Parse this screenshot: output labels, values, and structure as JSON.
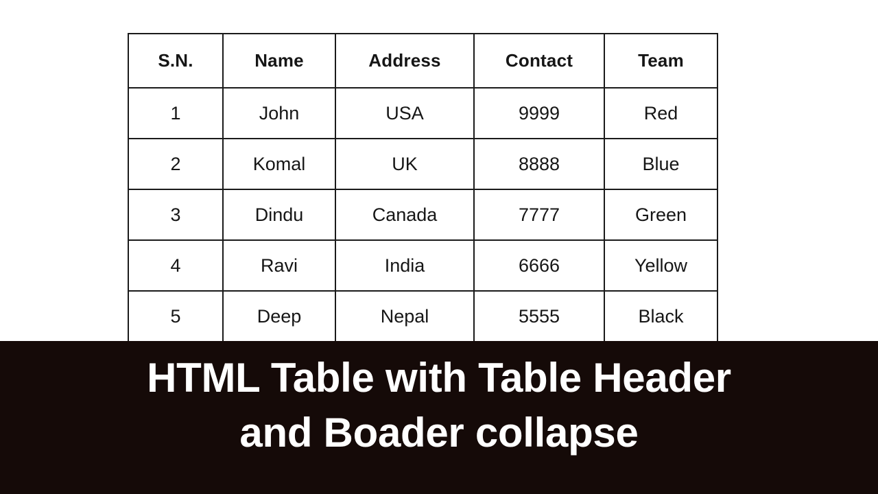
{
  "page": {
    "background_color": "#ffffff",
    "banner_color": "#150a08",
    "border_color": "#1a1a1a",
    "text_color": "#161616",
    "caption_text_color": "#ffffff"
  },
  "table": {
    "columns": [
      "S.N.",
      "Name",
      "Address",
      "Contact",
      "Team"
    ],
    "rows": [
      {
        "sn": "1",
        "name": "John",
        "address": "USA",
        "contact": "9999",
        "team": "Red"
      },
      {
        "sn": "2",
        "name": "Komal",
        "address": "UK",
        "contact": "8888",
        "team": "Blue"
      },
      {
        "sn": "3",
        "name": "Dindu",
        "address": "Canada",
        "contact": "7777",
        "team": "Green"
      },
      {
        "sn": "4",
        "name": "Ravi",
        "address": "India",
        "contact": "6666",
        "team": "Yellow"
      },
      {
        "sn": "5",
        "name": "Deep",
        "address": "Nepal",
        "contact": "5555",
        "team": "Black"
      }
    ]
  },
  "caption": {
    "line1": "HTML Table with Table Header",
    "line2": "and Boader collapse"
  }
}
